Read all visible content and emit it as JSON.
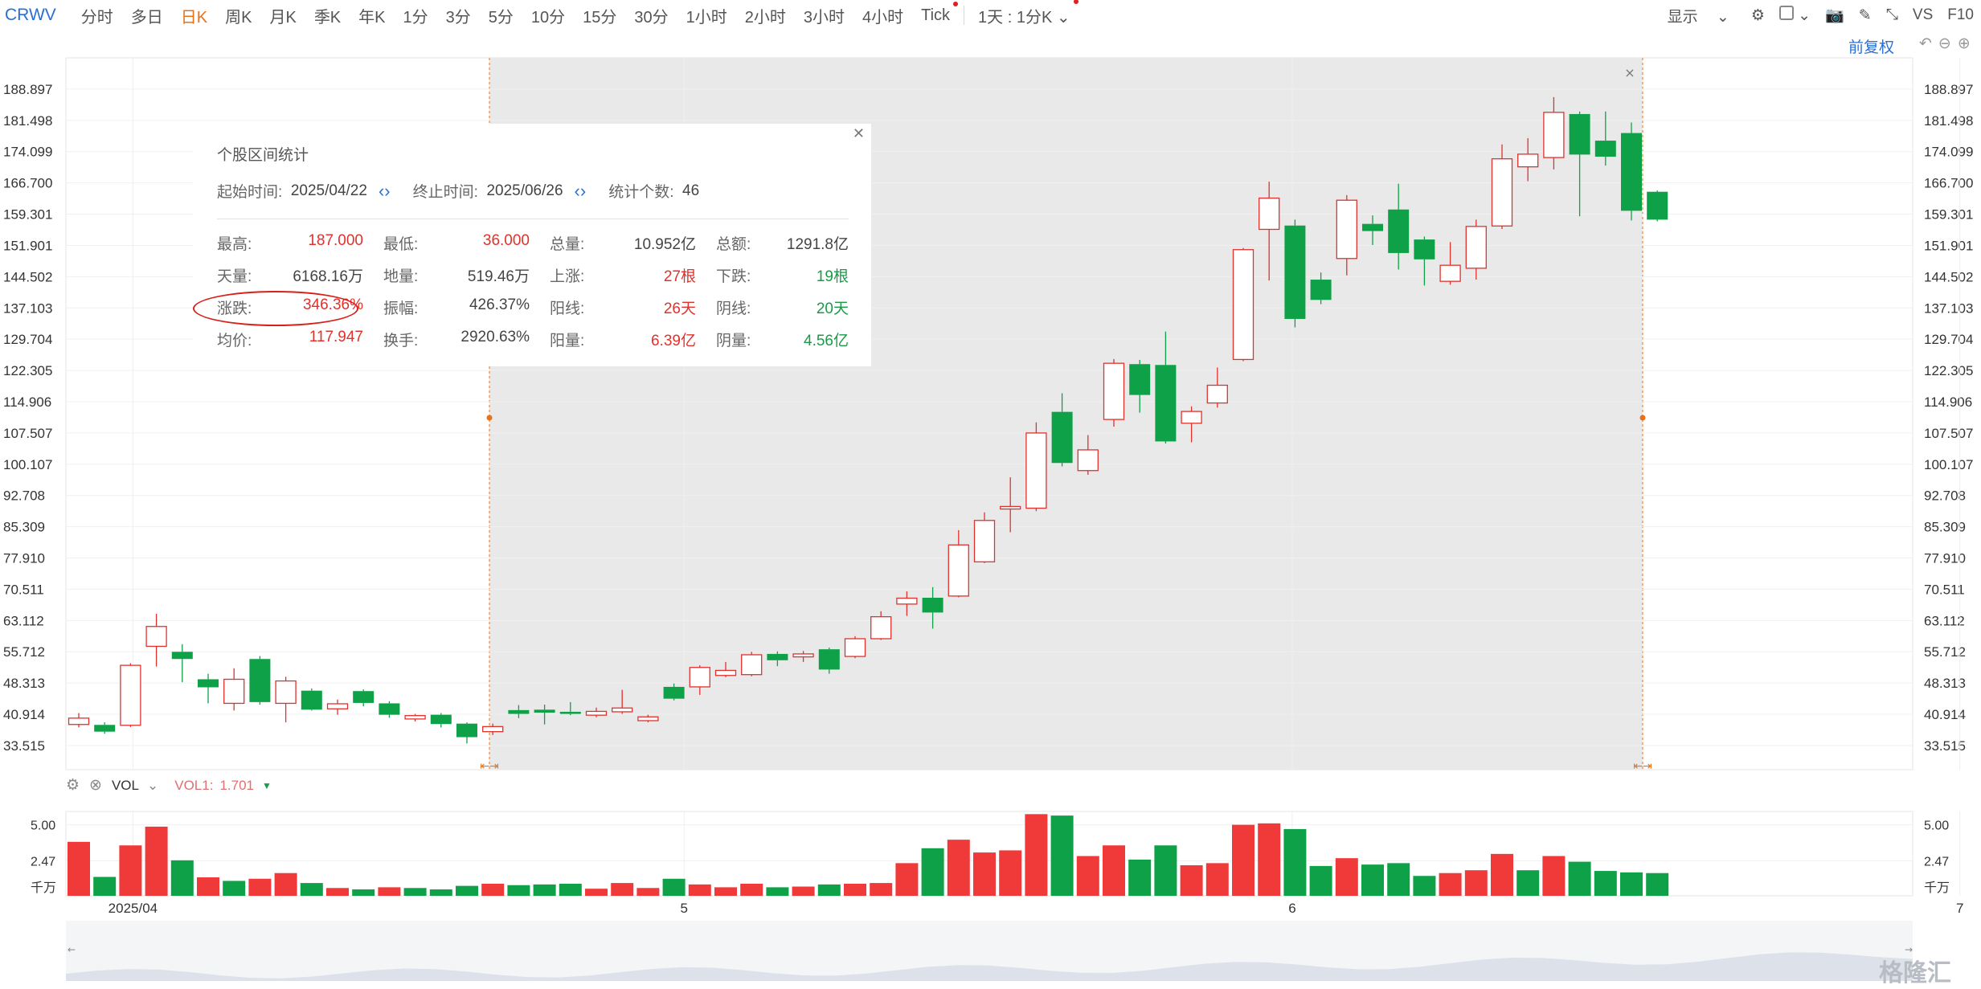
{
  "toolbar": {
    "symbol": "CRWV",
    "timeframes": [
      "分时",
      "多日",
      "日K",
      "周K",
      "月K",
      "季K",
      "年K",
      "1分",
      "3分",
      "5分",
      "10分",
      "15分",
      "30分",
      "1小时",
      "2小时",
      "3小时",
      "4小时",
      "Tick",
      "1天 : 1分K"
    ],
    "active": "日K",
    "right": {
      "display": "显示",
      "vs": "VS",
      "f10": "F10"
    }
  },
  "adjust_label": "前复权",
  "stats_panel": {
    "title": "个股区间统计",
    "start_label": "起始时间:",
    "start_value": "2025/04/22",
    "end_label": "终止时间:",
    "end_value": "2025/06/26",
    "count_label": "统计个数:",
    "count_value": "46",
    "rows": [
      [
        [
          "最高:",
          "187.000"
        ],
        [
          "最低:",
          "36.000"
        ],
        [
          "总量:",
          "10.952亿"
        ],
        [
          "总额:",
          "1291.8亿"
        ]
      ],
      [
        [
          "天量:",
          "6168.16万"
        ],
        [
          "地量:",
          "519.46万"
        ],
        [
          "上涨:",
          "27根"
        ],
        [
          "下跌:",
          "19根"
        ]
      ],
      [
        [
          "涨跌:",
          "346.36%"
        ],
        [
          "振幅:",
          "426.37%"
        ],
        [
          "阳线:",
          "26天"
        ],
        [
          "阴线:",
          "20天"
        ]
      ],
      [
        [
          "均价:",
          "117.947"
        ],
        [
          "换手:",
          "2920.63%"
        ],
        [
          "阳量:",
          "6.39亿"
        ],
        [
          "阴量:",
          "4.56亿"
        ]
      ]
    ],
    "value_colors": [
      [
        "red",
        "red",
        "dark",
        "dark"
      ],
      [
        "dark",
        "dark",
        "red",
        "green"
      ],
      [
        "red",
        "dark",
        "red",
        "green"
      ],
      [
        "red",
        "dark",
        "red",
        "green"
      ]
    ]
  },
  "volume_header": {
    "label": "VOL",
    "indicator": "VOL1:",
    "value": "1.701"
  },
  "watermark": "格隆汇",
  "colors": {
    "up": "#e0322d",
    "down": "#0fa147",
    "accent": "#e8711a",
    "link": "#2a6fd6"
  },
  "chart_data": [
    {
      "type": "candlestick",
      "y_ticks": [
        188.897,
        181.498,
        174.099,
        166.7,
        159.301,
        151.901,
        144.502,
        137.103,
        129.704,
        122.305,
        114.906,
        107.507,
        100.107,
        92.708,
        85.309,
        77.91,
        70.511,
        63.112,
        55.712,
        48.313,
        40.914,
        33.515
      ],
      "ylim": [
        27.8,
        196.3
      ],
      "x_ticks": [
        "2025/04",
        "5",
        "6",
        "7"
      ],
      "selection": {
        "start": "2025/04/22",
        "end": "2025/06/26"
      },
      "candles": [
        {
          "o": 38.5,
          "c": 40.0,
          "h": 41.2,
          "l": 37.8
        },
        {
          "o": 38.4,
          "c": 36.8,
          "h": 39.0,
          "l": 36.3
        },
        {
          "o": 38.3,
          "c": 52.5,
          "h": 53.0,
          "l": 37.9
        },
        {
          "o": 57.0,
          "c": 61.7,
          "h": 64.7,
          "l": 52.2
        },
        {
          "o": 55.7,
          "c": 54.0,
          "h": 57.5,
          "l": 48.5
        },
        {
          "o": 49.2,
          "c": 47.3,
          "h": 50.5,
          "l": 43.5
        },
        {
          "o": 43.5,
          "c": 49.2,
          "h": 51.8,
          "l": 41.8
        },
        {
          "o": 54.0,
          "c": 43.8,
          "h": 54.7,
          "l": 43.2
        },
        {
          "o": 43.5,
          "c": 48.8,
          "h": 49.8,
          "l": 39.0
        },
        {
          "o": 46.5,
          "c": 42.0,
          "h": 47.0,
          "l": 41.8
        },
        {
          "o": 42.2,
          "c": 43.4,
          "h": 44.4,
          "l": 40.8
        },
        {
          "o": 46.4,
          "c": 43.6,
          "h": 46.8,
          "l": 42.8
        },
        {
          "o": 43.5,
          "c": 40.8,
          "h": 44.0,
          "l": 40.1
        },
        {
          "o": 39.8,
          "c": 40.6,
          "h": 41.0,
          "l": 39.2
        },
        {
          "o": 40.8,
          "c": 38.6,
          "h": 41.2,
          "l": 37.8
        },
        {
          "o": 38.7,
          "c": 35.5,
          "h": 39.0,
          "l": 34.0
        },
        {
          "o": 36.8,
          "c": 38.0,
          "h": 38.7,
          "l": 36.0
        },
        {
          "o": 41.9,
          "c": 41.0,
          "h": 43.1,
          "l": 40.0
        },
        {
          "o": 42.0,
          "c": 41.3,
          "h": 43.2,
          "l": 38.5
        },
        {
          "o": 41.5,
          "c": 41.0,
          "h": 43.8,
          "l": 40.7
        },
        {
          "o": 40.7,
          "c": 41.6,
          "h": 42.5,
          "l": 40.2
        },
        {
          "o": 41.5,
          "c": 42.4,
          "h": 46.7,
          "l": 41.0
        },
        {
          "o": 39.4,
          "c": 40.3,
          "h": 40.8,
          "l": 39.0
        },
        {
          "o": 47.4,
          "c": 44.6,
          "h": 48.2,
          "l": 44.2
        },
        {
          "o": 47.4,
          "c": 52.0,
          "h": 52.5,
          "l": 45.5
        },
        {
          "o": 50.1,
          "c": 51.3,
          "h": 53.3,
          "l": 49.7
        },
        {
          "o": 50.3,
          "c": 55.0,
          "h": 55.7,
          "l": 49.9
        },
        {
          "o": 55.2,
          "c": 53.7,
          "h": 55.8,
          "l": 52.3
        },
        {
          "o": 54.5,
          "c": 55.2,
          "h": 55.9,
          "l": 53.3
        },
        {
          "o": 56.3,
          "c": 51.5,
          "h": 56.7,
          "l": 50.5
        },
        {
          "o": 54.6,
          "c": 58.8,
          "h": 59.4,
          "l": 54.2
        },
        {
          "o": 58.8,
          "c": 64.0,
          "h": 65.3,
          "l": 58.5
        },
        {
          "o": 67.0,
          "c": 68.4,
          "h": 70.0,
          "l": 64.2
        },
        {
          "o": 68.5,
          "c": 65.0,
          "h": 71.0,
          "l": 61.2
        },
        {
          "o": 68.9,
          "c": 81.0,
          "h": 84.5,
          "l": 68.6
        },
        {
          "o": 77.0,
          "c": 86.8,
          "h": 88.7,
          "l": 76.7
        },
        {
          "o": 89.5,
          "c": 90.1,
          "h": 97.0,
          "l": 84.0
        },
        {
          "o": 89.7,
          "c": 107.5,
          "h": 110.0,
          "l": 89.0
        },
        {
          "o": 112.5,
          "c": 100.4,
          "h": 116.9,
          "l": 99.6
        },
        {
          "o": 98.6,
          "c": 103.5,
          "h": 107.0,
          "l": 97.6
        },
        {
          "o": 110.7,
          "c": 124.0,
          "h": 125.0,
          "l": 109.0
        },
        {
          "o": 123.8,
          "c": 116.5,
          "h": 124.8,
          "l": 112.3
        },
        {
          "o": 123.6,
          "c": 105.5,
          "h": 131.5,
          "l": 105.0
        },
        {
          "o": 109.8,
          "c": 112.6,
          "h": 113.8,
          "l": 105.3
        },
        {
          "o": 114.6,
          "c": 118.8,
          "h": 123.0,
          "l": 113.5
        },
        {
          "o": 124.9,
          "c": 150.9,
          "h": 151.3,
          "l": 124.5
        },
        {
          "o": 155.7,
          "c": 163.1,
          "h": 167.0,
          "l": 143.6
        },
        {
          "o": 156.6,
          "c": 134.5,
          "h": 158.0,
          "l": 132.5
        },
        {
          "o": 143.8,
          "c": 139.0,
          "h": 145.5,
          "l": 138.0
        },
        {
          "o": 148.8,
          "c": 162.6,
          "h": 163.8,
          "l": 144.8
        },
        {
          "o": 157.0,
          "c": 155.3,
          "h": 159.0,
          "l": 152.0
        },
        {
          "o": 160.4,
          "c": 150.1,
          "h": 166.5,
          "l": 146.2
        },
        {
          "o": 153.3,
          "c": 148.6,
          "h": 154.0,
          "l": 142.4
        },
        {
          "o": 143.4,
          "c": 147.2,
          "h": 152.7,
          "l": 142.6
        },
        {
          "o": 146.5,
          "c": 156.4,
          "h": 158.0,
          "l": 143.8
        },
        {
          "o": 156.5,
          "c": 172.4,
          "h": 175.8,
          "l": 155.8
        },
        {
          "o": 170.5,
          "c": 173.5,
          "h": 177.3,
          "l": 167.1
        },
        {
          "o": 172.7,
          "c": 183.4,
          "h": 187.0,
          "l": 169.9
        },
        {
          "o": 183.0,
          "c": 173.4,
          "h": 183.6,
          "l": 158.8
        },
        {
          "o": 176.7,
          "c": 172.9,
          "h": 183.6,
          "l": 170.8
        },
        {
          "o": 178.5,
          "c": 160.1,
          "h": 181.0,
          "l": 157.8
        },
        {
          "o": 164.6,
          "c": 158.0,
          "h": 164.9,
          "l": 157.6
        }
      ]
    },
    {
      "type": "bar",
      "title": "VOL",
      "unit": "千万",
      "y_ticks": [
        5.0,
        2.47
      ],
      "ylim": [
        0,
        5.94
      ],
      "values": [
        3.8,
        1.33,
        3.55,
        4.87,
        2.5,
        1.3,
        1.05,
        1.2,
        1.6,
        0.9,
        0.55,
        0.45,
        0.6,
        0.55,
        0.45,
        0.7,
        0.85,
        0.75,
        0.8,
        0.85,
        0.5,
        0.9,
        0.55,
        1.2,
        0.8,
        0.6,
        0.85,
        0.6,
        0.65,
        0.8,
        0.85,
        0.9,
        2.3,
        3.35,
        3.95,
        3.05,
        3.2,
        5.75,
        5.65,
        2.8,
        3.55,
        2.55,
        3.55,
        2.15,
        2.3,
        5.0,
        5.1,
        4.7,
        2.1,
        2.65,
        2.2,
        2.3,
        1.4,
        1.6,
        1.8,
        2.95,
        1.8,
        2.8,
        2.4,
        1.75,
        1.65,
        1.6
      ],
      "up": [
        true,
        false,
        true,
        true,
        false,
        true,
        false,
        true,
        true,
        false,
        true,
        false,
        true,
        false,
        false,
        false,
        true,
        false,
        false,
        false,
        true,
        true,
        true,
        false,
        true,
        true,
        true,
        false,
        true,
        false,
        true,
        true,
        true,
        false,
        true,
        true,
        true,
        true,
        false,
        true,
        true,
        false,
        false,
        true,
        true,
        true,
        true,
        false,
        false,
        true,
        false,
        false,
        false,
        true,
        true,
        true,
        false,
        true,
        false,
        false,
        false,
        false
      ]
    }
  ]
}
